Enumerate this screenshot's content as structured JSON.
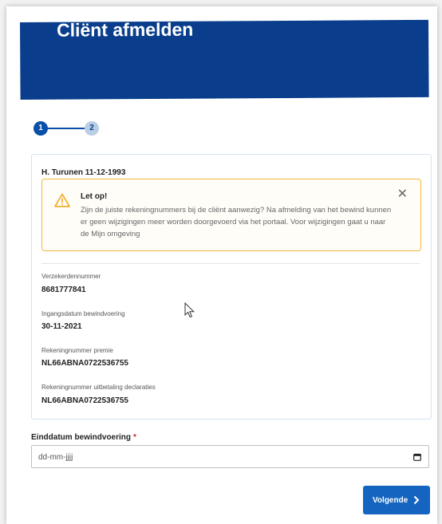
{
  "header": {
    "title": "Cliënt afmelden"
  },
  "stepper": {
    "steps": [
      "1",
      "2"
    ],
    "active": 1
  },
  "client": {
    "name": "H. Turunen 11-12-1993"
  },
  "alert": {
    "title": "Let op!",
    "text": "Zijn de juiste rekeningnummers bij de cliënt aanwezig? Na afmelding van het bewind kunnen er geen wijzigingen meer worden doorgevoerd via het portaal. Voor wijzigingen gaat u naar de Mijn omgeving",
    "icon": "warning-icon",
    "close_icon": "close-icon",
    "color": "#f5b73b"
  },
  "fields": [
    {
      "label": "Verzekerdennummer",
      "value": "8681777841"
    },
    {
      "label": "Ingangsdatum bewindvoering",
      "value": "30-11-2021"
    },
    {
      "label": "Rekeningnummer premie",
      "value": "NL66ABNA0722536755"
    },
    {
      "label": "Rekeningnummer uitbetaling declaraties",
      "value": "NL66ABNA0722536755"
    }
  ],
  "end_date": {
    "label": "Einddatum bewindvoering",
    "required_mark": "*",
    "placeholder": "dd-mm-jjjj",
    "icon": "calendar-icon"
  },
  "next_button": {
    "label": "Volgende",
    "icon": "chevron-right-icon"
  },
  "colors": {
    "brand": "#0a3e8c",
    "button": "#1565c0",
    "warning": "#f5b73b",
    "required": "#c62828"
  }
}
